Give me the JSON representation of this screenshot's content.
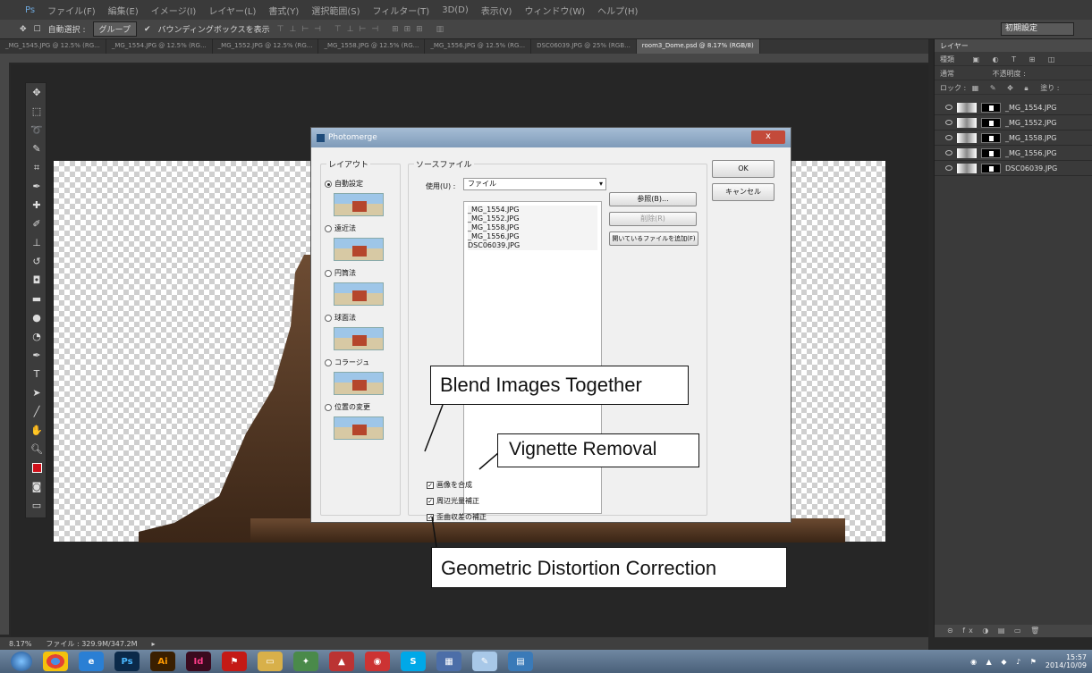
{
  "menu": {
    "items": [
      "ファイル(F)",
      "編集(E)",
      "イメージ(I)",
      "レイヤー(L)",
      "書式(Y)",
      "選択範囲(S)",
      "フィルター(T)",
      "3D(D)",
      "表示(V)",
      "ウィンドウ(W)",
      "ヘルプ(H)"
    ]
  },
  "options": {
    "auto_select_label": "自動選択 :",
    "auto_select_value": "グループ",
    "bbox_label": "バウンディングボックスを表示",
    "workspace": "初期設定"
  },
  "tabs": [
    "_MG_1545.JPG @ 12.5% (RG...",
    "_MG_1554.JPG @ 12.5% (RG...",
    "_MG_1552.JPG @ 12.5% (RG...",
    "_MG_1558.JPG @ 12.5% (RG...",
    "_MG_1556.JPG @ 12.5% (RG...",
    "DSC06039.JPG @ 25% (RGB...",
    "room3_Dome.psd @ 8.17% (RGB/8)"
  ],
  "status": {
    "zoom": "8.17%",
    "file": "ファイル : 329.9M/347.2M"
  },
  "layers_panel": {
    "title": "レイヤー",
    "kind": "種類",
    "blend": "通常",
    "opacity": "不透明度 :",
    "lock": "ロック :",
    "fill": "塗り :",
    "layers": [
      "_MG_1554.JPG",
      "_MG_1552.JPG",
      "_MG_1558.JPG",
      "_MG_1556.JPG",
      "DSC06039.JPG"
    ]
  },
  "dialog": {
    "title": "Photomerge",
    "close": "x",
    "layout_legend": "レイアウト",
    "layout_options": [
      "自動設定",
      "遠近法",
      "円筒法",
      "球面法",
      "コラージュ",
      "位置の変更"
    ],
    "source_legend": "ソースファイル",
    "use_label": "使用(U) :",
    "use_value": "ファイル",
    "files": [
      "_MG_1554.JPG",
      "_MG_1552.JPG",
      "_MG_1558.JPG",
      "_MG_1556.JPG",
      "DSC06039.JPG"
    ],
    "browse": "参照(B)...",
    "remove": "削除(R)",
    "add_open": "開いているファイルを追加(F)",
    "ok": "OK",
    "cancel": "キャンセル",
    "checkboxes": [
      "画像を合成",
      "周辺光量補正",
      "歪曲収差の補正"
    ]
  },
  "callouts": {
    "blend": "Blend Images Together",
    "vignette": "Vignette Removal",
    "geometric": "Geometric Distortion Correction"
  },
  "taskbar": {
    "apps": [
      "Ps",
      "Ai",
      "Id"
    ],
    "time": "15:57",
    "date": "2014/10/09"
  }
}
